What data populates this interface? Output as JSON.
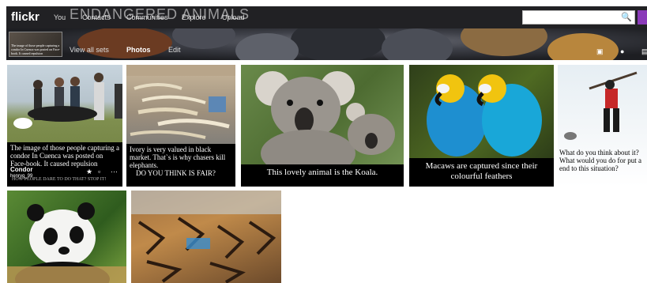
{
  "topbar": {
    "logo": "flickr",
    "nav": [
      "You",
      "Contacts",
      "Communities",
      "Explore",
      "Upload"
    ],
    "search": {
      "placeholder": "",
      "value": ""
    }
  },
  "banner": {
    "set_title": "ENDANGERED ANIMALS",
    "thumb_caption": "The image of those people capturing a condor In Cuenca was posted on Face-book. It caused repulsion",
    "photos_label": "Photos",
    "subnav": [
      "View all sets",
      "Photos",
      "Edit"
    ]
  },
  "photos": [
    {
      "caption": "The image of those people capturing a condor In Cuenca was posted on Face-book. It caused repulsion",
      "title": "Condor",
      "owner": "henryg_99",
      "watermark": "HOW PEOPLE DARE TO DO THAT? STOP IT!"
    },
    {
      "caption_line1": "Ivory  is very valued in black market.  That`s is why chasers kill elephants.",
      "caption_line2": "DO YOU THINK IS FAIR?"
    },
    {
      "caption": "This lovely animal is the Koala."
    },
    {
      "caption": "Macaws are captured since their colourful feathers"
    },
    {
      "caption": "What do you think about it? What would you do for put a end to this situation?"
    }
  ],
  "icons": {
    "star": "star-icon",
    "comment": "comment-icon",
    "more": "more-icon"
  }
}
